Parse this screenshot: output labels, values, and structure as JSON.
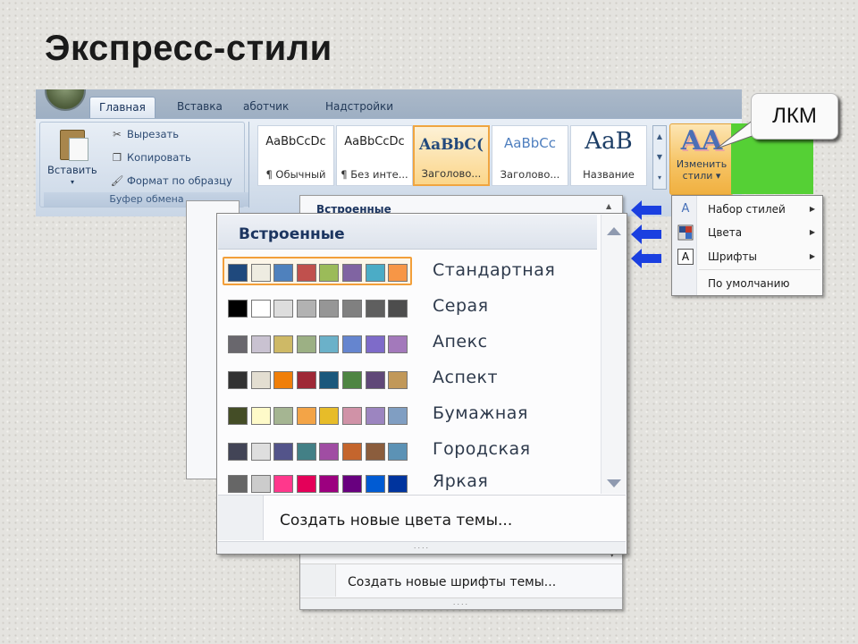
{
  "slide_title": "Экспресс-стили",
  "ribbon": {
    "tabs": [
      {
        "label": "Главная",
        "active": true
      },
      {
        "label": "Вставка",
        "active": false
      },
      {
        "label": "аботчик",
        "active": false
      },
      {
        "label": "Надстройки",
        "active": false
      }
    ],
    "clipboard": {
      "paste_label": "Вставить",
      "paste_arrow": "▾",
      "cut_label": "Вырезать",
      "copy_label": "Копировать",
      "format_label": "Формат по образцу",
      "group_label": "Буфер обмена"
    },
    "styles": [
      {
        "sample": "AaBbCcDc",
        "label": "¶ Обычный"
      },
      {
        "sample": "AaBbCcDc",
        "label": "¶ Без инте..."
      },
      {
        "sample": "AaBbC(",
        "label": "Заголово...",
        "selected": true
      },
      {
        "sample": "AaBbCc",
        "label": "Заголово..."
      },
      {
        "sample": "AaB",
        "label": "Название"
      }
    ],
    "change_styles": {
      "icon": "AA",
      "line1": "Изменить",
      "line2": "стили ▾"
    }
  },
  "callout": {
    "text": "ЛКМ"
  },
  "submenu": {
    "items": [
      {
        "label": "Набор стилей",
        "icon": "style-set-icon",
        "arrow": "▶"
      },
      {
        "label": "Цвета",
        "icon": "colors-icon",
        "arrow": "▶"
      },
      {
        "label": "Шрифты",
        "icon": "fonts-icon",
        "arrow": "▶"
      },
      {
        "label": "По умолчанию",
        "icon": "",
        "arrow": ""
      }
    ]
  },
  "back_menu": {
    "title": "Встроенные",
    "create_label": "Создать новые шрифты темы...",
    "grip": "....",
    "scroll_down": "▾"
  },
  "dropdown": {
    "header": "Встроенные",
    "themes": [
      {
        "name": "Стандартная",
        "selected": true,
        "colors": [
          "#1f497d",
          "#eeece1",
          "#4f81bd",
          "#c0504d",
          "#9bbb59",
          "#8064a2",
          "#4bacc6",
          "#f79646"
        ]
      },
      {
        "name": "Серая",
        "selected": false,
        "colors": [
          "#000000",
          "#ffffff",
          "#dddddd",
          "#b2b2b2",
          "#969696",
          "#808080",
          "#5f5f5f",
          "#4d4d4d"
        ]
      },
      {
        "name": "Апекс",
        "selected": false,
        "colors": [
          "#69676d",
          "#c9c2d1",
          "#ceb966",
          "#9cb084",
          "#6bb1c9",
          "#6585cf",
          "#7e6bc9",
          "#a379bb"
        ]
      },
      {
        "name": "Аспект",
        "selected": false,
        "colors": [
          "#323232",
          "#e3ded1",
          "#f07f09",
          "#9f2936",
          "#1b587c",
          "#4e8542",
          "#604878",
          "#c19859"
        ]
      },
      {
        "name": "Бумажная",
        "selected": false,
        "colors": [
          "#444d26",
          "#fefac9",
          "#a5b592",
          "#f3a447",
          "#e7bc29",
          "#d092a7",
          "#9c85c0",
          "#809ec2"
        ]
      },
      {
        "name": "Городская",
        "selected": false,
        "colors": [
          "#424456",
          "#dedede",
          "#53548a",
          "#438086",
          "#a04da3",
          "#c4652d",
          "#8b5d3d",
          "#5c92b5"
        ]
      },
      {
        "name": "Яркая",
        "selected": false,
        "colors": [
          "#666666",
          "#cccccc",
          "#ff388c",
          "#e40059",
          "#9c007f",
          "#68007f",
          "#005bd3",
          "#00349e"
        ]
      }
    ],
    "create_label": "Создать новые цвета темы...",
    "grip": "...."
  },
  "colors": {
    "accent_green": "#55d035",
    "arrow_blue": "#1a3fe0",
    "selection_orange": "#f29f3a"
  }
}
